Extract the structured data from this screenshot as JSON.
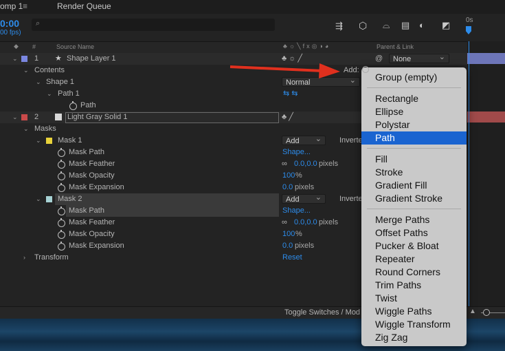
{
  "tabs": {
    "comp": "omp 1",
    "render_queue": "Render Queue"
  },
  "time": {
    "timecode": "0:00",
    "fps": "00 fps)"
  },
  "timeline": {
    "start_label": "0s"
  },
  "columns": {
    "hash": "#",
    "source_name": "Source Name",
    "parent_link": "Parent & Link"
  },
  "layers": [
    {
      "num": "1",
      "name": "Shape Layer 1",
      "parent": "None",
      "color": "#7a86e0"
    },
    {
      "num": "2",
      "name": "Light Gray Solid 1",
      "color": "#c94a4a"
    }
  ],
  "shape_props": {
    "contents": "Contents",
    "add": "Add:",
    "shape1": "Shape 1",
    "blend": "Normal",
    "path1": "Path 1",
    "path": "Path"
  },
  "masks": {
    "label": "Masks",
    "items": [
      {
        "name": "Mask 1",
        "mode": "Add",
        "inverted": "Inverte",
        "color": "#e8d23a"
      },
      {
        "name": "Mask 2",
        "mode": "Add",
        "inverted": "Inverte",
        "color": "#a7d2d4"
      }
    ],
    "props": {
      "mask_path": "Mask Path",
      "shape_val": "Shape...",
      "mask_feather": "Mask Feather",
      "feather_val": "0.0,0.0",
      "mask_opacity": "Mask Opacity",
      "opacity_val": "100",
      "percent": "%",
      "mask_expansion": "Mask Expansion",
      "expansion_val": "0.0",
      "pixels": "pixels"
    }
  },
  "transform": {
    "label": "Transform",
    "reset": "Reset"
  },
  "bottom": {
    "toggle": "Toggle Switches / Mod"
  },
  "menu": {
    "items": [
      "Group (empty)",
      "Rectangle",
      "Ellipse",
      "Polystar",
      "Path",
      "Fill",
      "Stroke",
      "Gradient Fill",
      "Gradient Stroke",
      "Merge Paths",
      "Offset Paths",
      "Pucker & Bloat",
      "Repeater",
      "Round Corners",
      "Trim Paths",
      "Twist",
      "Wiggle Paths",
      "Wiggle Transform",
      "Zig Zag"
    ],
    "selected": "Path"
  },
  "colors": {
    "accent": "#2d8ceb",
    "menu_highlight": "#1a64d0",
    "arrow": "#e0301e"
  }
}
